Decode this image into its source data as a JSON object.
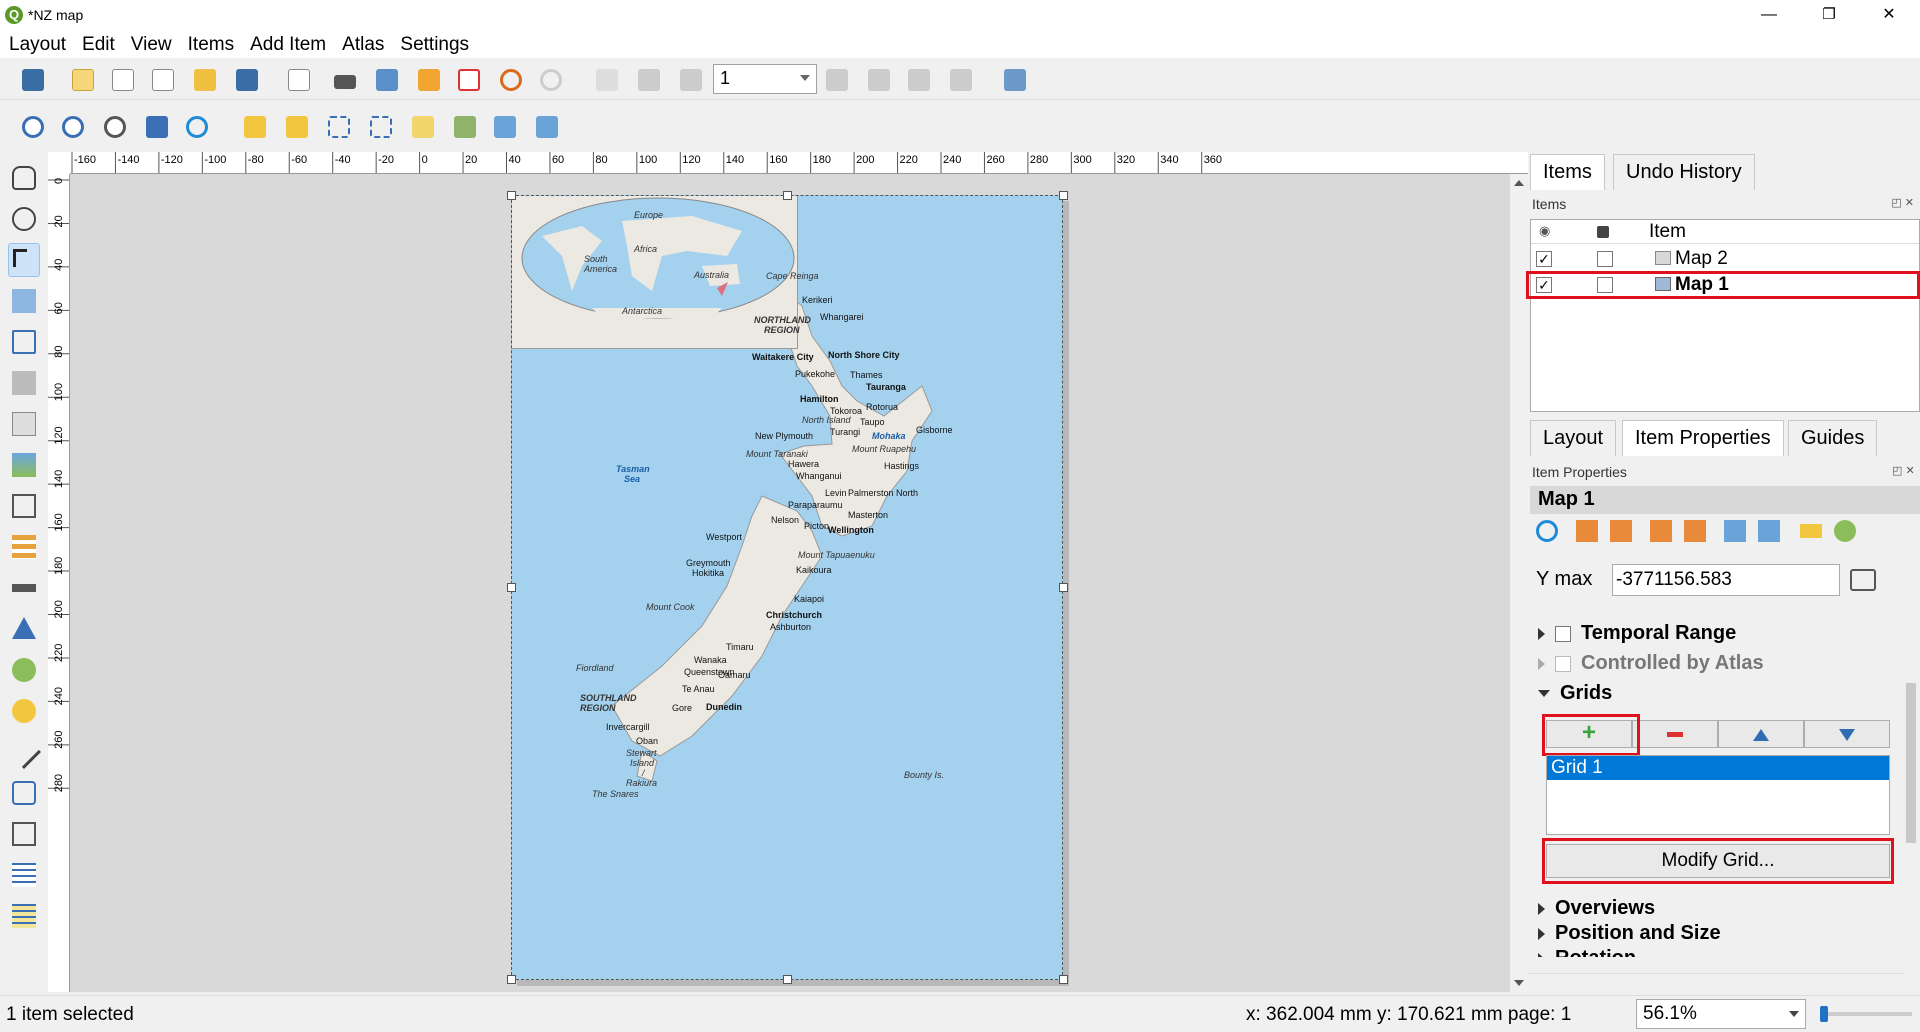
{
  "window": {
    "title": "*NZ map",
    "minimize": "—",
    "restore": "❐",
    "close": "✕"
  },
  "menu": [
    "Layout",
    "Edit",
    "View",
    "Items",
    "Add Item",
    "Atlas",
    "Settings"
  ],
  "toolbar": {
    "page_number": "1"
  },
  "ruler": {
    "h_ticks": [
      "-160",
      "-140",
      "-120",
      "-100",
      "-80",
      "-60",
      "-40",
      "-20",
      "0",
      "20",
      "40",
      "60",
      "80",
      "100",
      "120",
      "140",
      "160",
      "180",
      "200",
      "220",
      "240",
      "260",
      "280",
      "300",
      "320",
      "340",
      "360"
    ],
    "v_ticks": [
      "0",
      "20",
      "40",
      "60",
      "80",
      "100",
      "120",
      "140",
      "160",
      "180",
      "200",
      "220",
      "240",
      "260",
      "280"
    ]
  },
  "map": {
    "inset_labels": [
      "Europe",
      "Africa",
      "South",
      "America",
      "Australia",
      "Antarctica"
    ],
    "labels": [
      {
        "t": "Cape Reinga",
        "c": "it"
      },
      {
        "t": "Kerikeri",
        "c": ""
      },
      {
        "t": "Whangarei",
        "c": ""
      },
      {
        "t": "NORTHLAND",
        "c": "it b"
      },
      {
        "t": "REGION",
        "c": "it b"
      },
      {
        "t": "Waitakere City",
        "c": "b"
      },
      {
        "t": "North Shore City",
        "c": "b"
      },
      {
        "t": "Pukekohe",
        "c": ""
      },
      {
        "t": "Thames",
        "c": ""
      },
      {
        "t": "Hamilton",
        "c": "b"
      },
      {
        "t": "Tauranga",
        "c": "b"
      },
      {
        "t": "Tokoroa",
        "c": ""
      },
      {
        "t": "Rotorua",
        "c": ""
      },
      {
        "t": "North Island",
        "c": "it"
      },
      {
        "t": "Taupo",
        "c": ""
      },
      {
        "t": "Gisborne",
        "c": ""
      },
      {
        "t": "New Plymouth",
        "c": ""
      },
      {
        "t": "Turangi",
        "c": ""
      },
      {
        "t": "Mohaka",
        "c": "blue"
      },
      {
        "t": "Mount Taranaki",
        "c": "it"
      },
      {
        "t": "Mount Ruapehu",
        "c": "it"
      },
      {
        "t": "Hawera",
        "c": ""
      },
      {
        "t": "Hastings",
        "c": ""
      },
      {
        "t": "Whanganui",
        "c": ""
      },
      {
        "t": "Tasman",
        "c": "blue"
      },
      {
        "t": "Sea",
        "c": "blue"
      },
      {
        "t": "Levin",
        "c": ""
      },
      {
        "t": "Palmerston North",
        "c": ""
      },
      {
        "t": "Paraparaumu",
        "c": ""
      },
      {
        "t": "Masterton",
        "c": ""
      },
      {
        "t": "Nelson",
        "c": ""
      },
      {
        "t": "Picton",
        "c": ""
      },
      {
        "t": "Wellington",
        "c": "b"
      },
      {
        "t": "Westport",
        "c": ""
      },
      {
        "t": "Mount Tapuaenuku",
        "c": "it"
      },
      {
        "t": "Greymouth",
        "c": ""
      },
      {
        "t": "Hokitika",
        "c": ""
      },
      {
        "t": "Kaikoura",
        "c": ""
      },
      {
        "t": "Kaiapoi",
        "c": ""
      },
      {
        "t": "Mount Cook",
        "c": "it"
      },
      {
        "t": "Christchurch",
        "c": "b"
      },
      {
        "t": "Ashburton",
        "c": ""
      },
      {
        "t": "Timaru",
        "c": ""
      },
      {
        "t": "Fiordland",
        "c": "it"
      },
      {
        "t": "Wanaka",
        "c": ""
      },
      {
        "t": "Queenstown",
        "c": ""
      },
      {
        "t": "Oamaru",
        "c": ""
      },
      {
        "t": "Te Anau",
        "c": ""
      },
      {
        "t": "SOUTHLAND",
        "c": "it b"
      },
      {
        "t": "REGION",
        "c": "it b"
      },
      {
        "t": "Dunedin",
        "c": "b"
      },
      {
        "t": "Gore",
        "c": ""
      },
      {
        "t": "Invercargill",
        "c": ""
      },
      {
        "t": "Oban",
        "c": ""
      },
      {
        "t": "Stewart",
        "c": "it"
      },
      {
        "t": "Island",
        "c": "it"
      },
      {
        "t": "/",
        "c": "it"
      },
      {
        "t": "Rakiura",
        "c": "it"
      },
      {
        "t": "Bounty Is.",
        "c": "it"
      },
      {
        "t": "The Snares",
        "c": "it"
      }
    ]
  },
  "panel_top": {
    "tabs": [
      "Items",
      "Undo History"
    ],
    "header": "Items",
    "column": "Item",
    "rows": [
      {
        "name": "Map 2",
        "visible": "✓",
        "bold": false
      },
      {
        "name": "Map 1",
        "visible": "✓",
        "bold": true
      }
    ]
  },
  "panel_bottom": {
    "tabs": [
      "Layout",
      "Item Properties",
      "Guides"
    ],
    "header": "Item Properties",
    "item_title": "Map 1",
    "ymax_label": "Y max",
    "ymax_value": "-3771156.583",
    "sections": {
      "temporal": "Temporal Range",
      "atlas": "Controlled by Atlas",
      "grids": "Grids",
      "overviews": "Overviews",
      "position": "Position and Size",
      "rotation": "Rotation"
    },
    "grids_list": [
      "Grid 1"
    ],
    "modify_grid": "Modify Grid..."
  },
  "status": {
    "selection": "1 item selected",
    "coords": "x: 362.004 mm y: 170.621 mm page: 1",
    "zoom": "56.1%"
  },
  "colors": {
    "accent": "#0078d7",
    "highlight": "#e0101f",
    "sea": "#a4d1ee",
    "land": "#ece9e3"
  }
}
